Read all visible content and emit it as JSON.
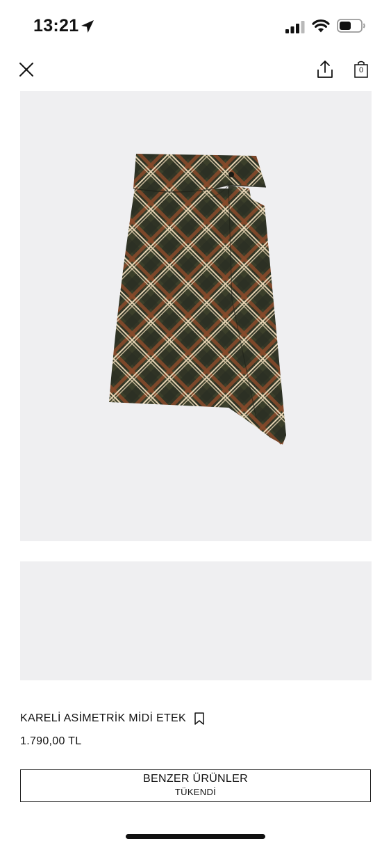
{
  "status_bar": {
    "time": "13:21",
    "icons": [
      "location-arrow-icon",
      "cellular-signal-icon",
      "wifi-icon",
      "battery-icon"
    ]
  },
  "header": {
    "icons": [
      "close-icon",
      "share-icon",
      "shopping-bag-icon"
    ],
    "bag_count": "0"
  },
  "product": {
    "title": "KARELİ ASİMETRİK MİDİ ETEK",
    "price": "1.790,00 TL",
    "bookmark_icon": "bookmark-icon"
  },
  "similar_products": {
    "label": "BENZER ÜRÜNLER",
    "status": "TÜKENDİ"
  },
  "colors": {
    "image_background": "#efeff1",
    "skirt_base": "#3b3f2a",
    "plaid_light": "#e6d3b3",
    "plaid_rust": "#8a4a2a"
  }
}
